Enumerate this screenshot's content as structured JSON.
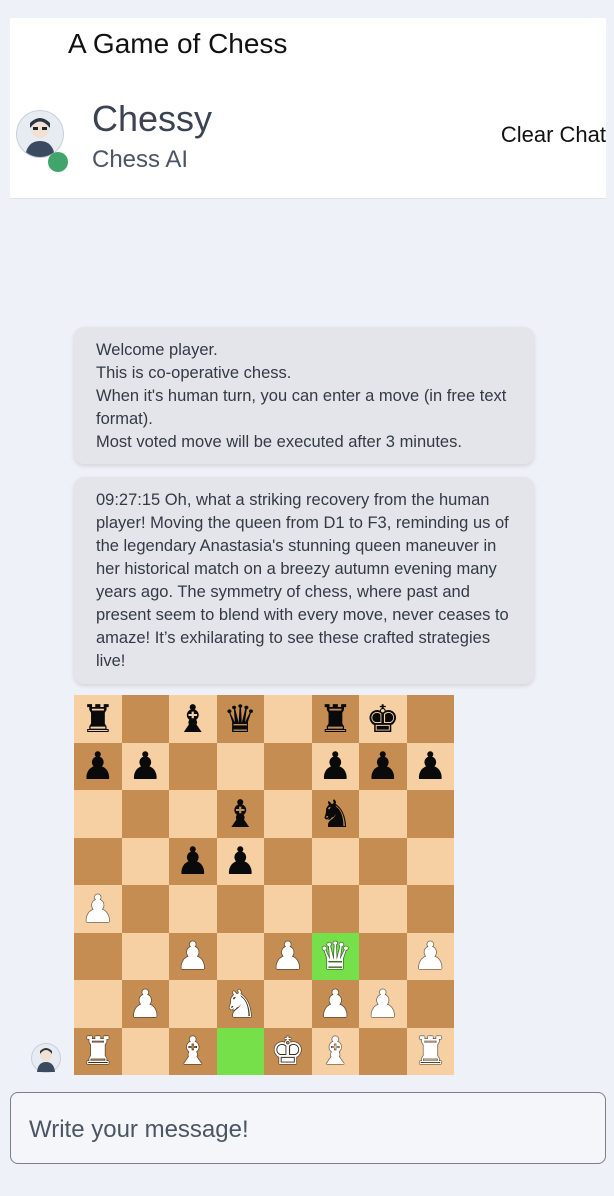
{
  "app": {
    "title": "A Game of Chess"
  },
  "bot": {
    "name": "Chessy",
    "subtitle": "Chess AI"
  },
  "header": {
    "clear_chat_label": "Clear Chat"
  },
  "messages": [
    {
      "text": "Welcome player.\nThis is co-operative chess.\nWhen it's human turn, you can enter a move (in free text format).\nMost voted move will be executed after 3 minutes."
    },
    {
      "text": "09:27:15 Oh, what a striking recovery from the human player! Moving the queen from D1 to F3, reminding us of the legendary Anastasia's stunning queen maneuver in her historical match on a breezy autumn evening many years ago. The symmetry of chess, where past and present seem to blend with every move, never ceases to amaze! It’s exhilarating to see these crafted strategies live!"
    }
  ],
  "board": {
    "ranks": [
      [
        "r",
        "",
        "b",
        "q",
        "",
        "r",
        "k",
        ""
      ],
      [
        "p",
        "p",
        "",
        "",
        "",
        "p",
        "p",
        "p"
      ],
      [
        "",
        "",
        "",
        "b",
        "",
        "n",
        "",
        ""
      ],
      [
        "",
        "",
        "p",
        "p",
        "",
        "",
        "",
        ""
      ],
      [
        "P",
        "",
        "",
        "",
        "",
        "",
        "",
        ""
      ],
      [
        "",
        "",
        "P",
        "",
        "P",
        "Q",
        "",
        "P"
      ],
      [
        "",
        "P",
        "",
        "N",
        "",
        "P",
        "P",
        ""
      ],
      [
        "R",
        "",
        "B",
        "",
        "K",
        "B",
        "",
        "R"
      ]
    ],
    "highlight_squares": [
      "d1",
      "f3"
    ],
    "colors": {
      "light": "#f6d0a2",
      "dark": "#c58d52",
      "highlight": "#76e04a"
    }
  },
  "composer": {
    "placeholder": "Write your message!"
  },
  "colors": {
    "online": "#3fa56b",
    "bubble": "#e3e5ea",
    "background": "#eef1f7"
  }
}
